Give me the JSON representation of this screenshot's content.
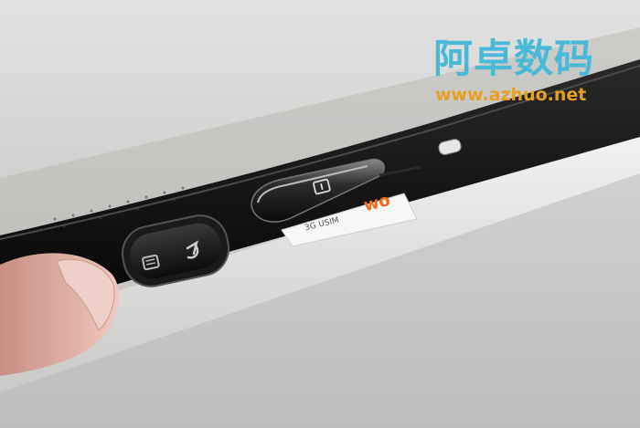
{
  "watermark": {
    "title": "阿卓数码",
    "url": "www.azhuo.net",
    "title_color": "#4ab9d8",
    "url_color": "#e8a020"
  },
  "sim_card": {
    "logo": "wo",
    "text": "3G USIM",
    "logo_color": "#f06a1a"
  },
  "colors": {
    "background": "#cfcfcd",
    "device_body": "#121212",
    "device_bezel": "#e4e4e2",
    "skin": "#d9a59a"
  },
  "icons": [
    "menu-icon",
    "back-arrow-icon",
    "sim-icon",
    "camera-icon"
  ]
}
